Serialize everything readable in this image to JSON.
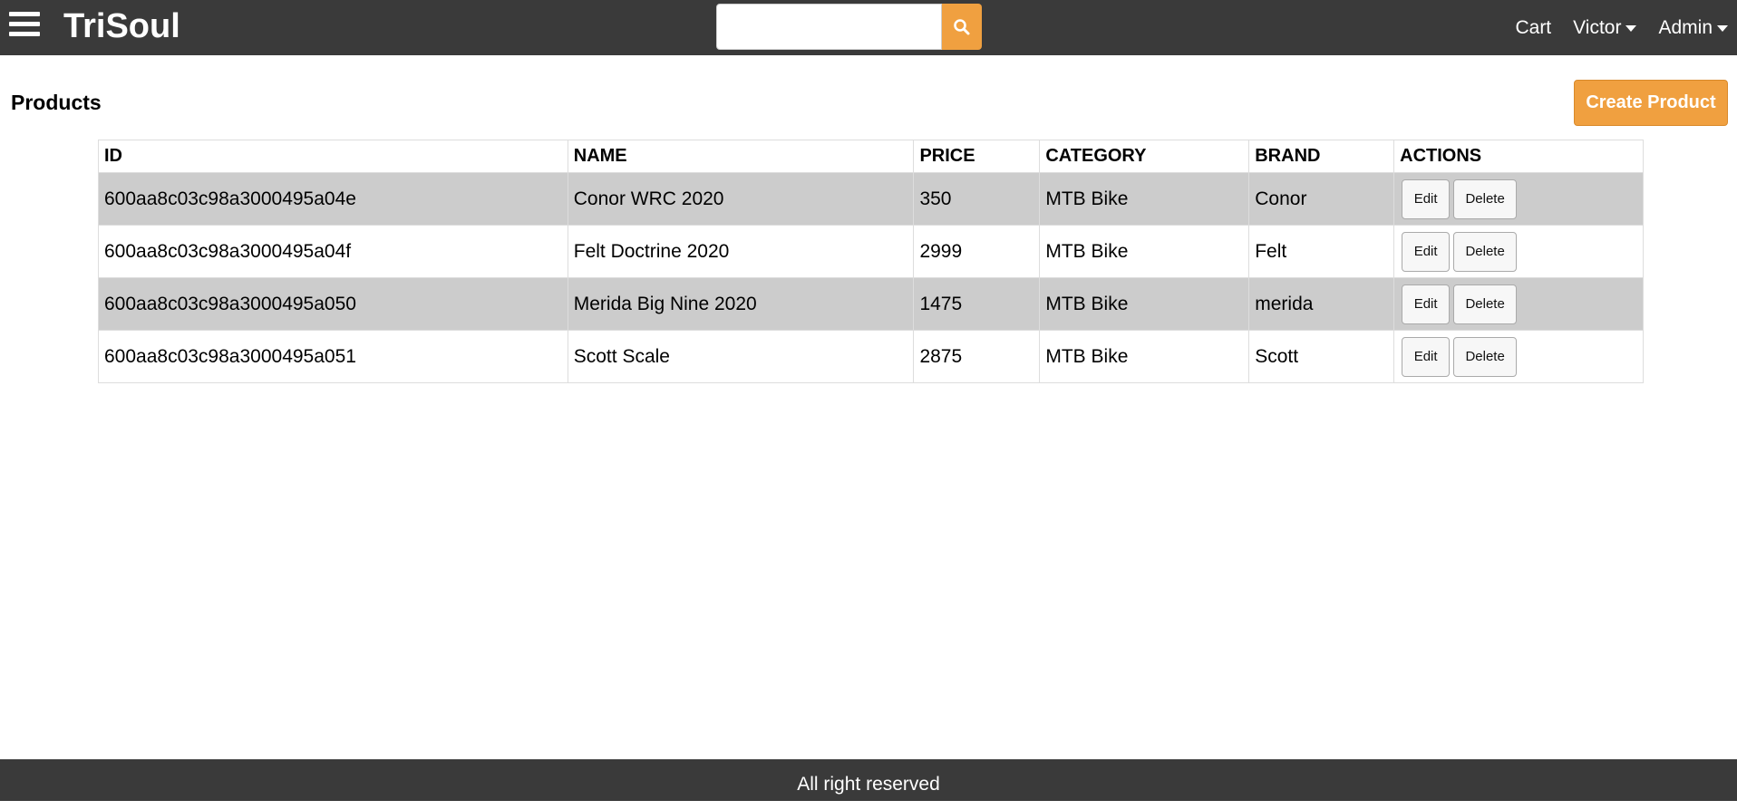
{
  "header": {
    "brand": "TriSoul",
    "search": {
      "value": "",
      "placeholder": ""
    },
    "nav": {
      "cart": "Cart",
      "user": "Victor",
      "admin": "Admin"
    }
  },
  "main": {
    "title": "Products",
    "create_label": "Create Product",
    "table": {
      "headers": [
        "ID",
        "NAME",
        "PRICE",
        "CATEGORY",
        "BRAND",
        "ACTIONS"
      ],
      "rows": [
        {
          "id": "600aa8c03c98a3000495a04e",
          "name": "Conor WRC 2020",
          "price": "350",
          "category": "MTB Bike",
          "brand": "Conor",
          "edit": "Edit",
          "delete": "Delete"
        },
        {
          "id": "600aa8c03c98a3000495a04f",
          "name": "Felt Doctrine 2020",
          "price": "2999",
          "category": "MTB Bike",
          "brand": "Felt",
          "edit": "Edit",
          "delete": "Delete"
        },
        {
          "id": "600aa8c03c98a3000495a050",
          "name": "Merida Big Nine 2020",
          "price": "1475",
          "category": "MTB Bike",
          "brand": "merida",
          "edit": "Edit",
          "delete": "Delete"
        },
        {
          "id": "600aa8c03c98a3000495a051",
          "name": "Scott Scale",
          "price": "2875",
          "category": "MTB Bike",
          "brand": "Scott",
          "edit": "Edit",
          "delete": "Delete"
        }
      ]
    }
  },
  "footer": {
    "text": "All right reserved"
  },
  "colors": {
    "header_bg": "#3a3a3a",
    "accent": "#f0a040",
    "row_shade": "#cccccc"
  },
  "icons": {
    "menu": "hamburger-menu-icon",
    "search": "search-icon",
    "dropdown": "caret-down-icon"
  }
}
